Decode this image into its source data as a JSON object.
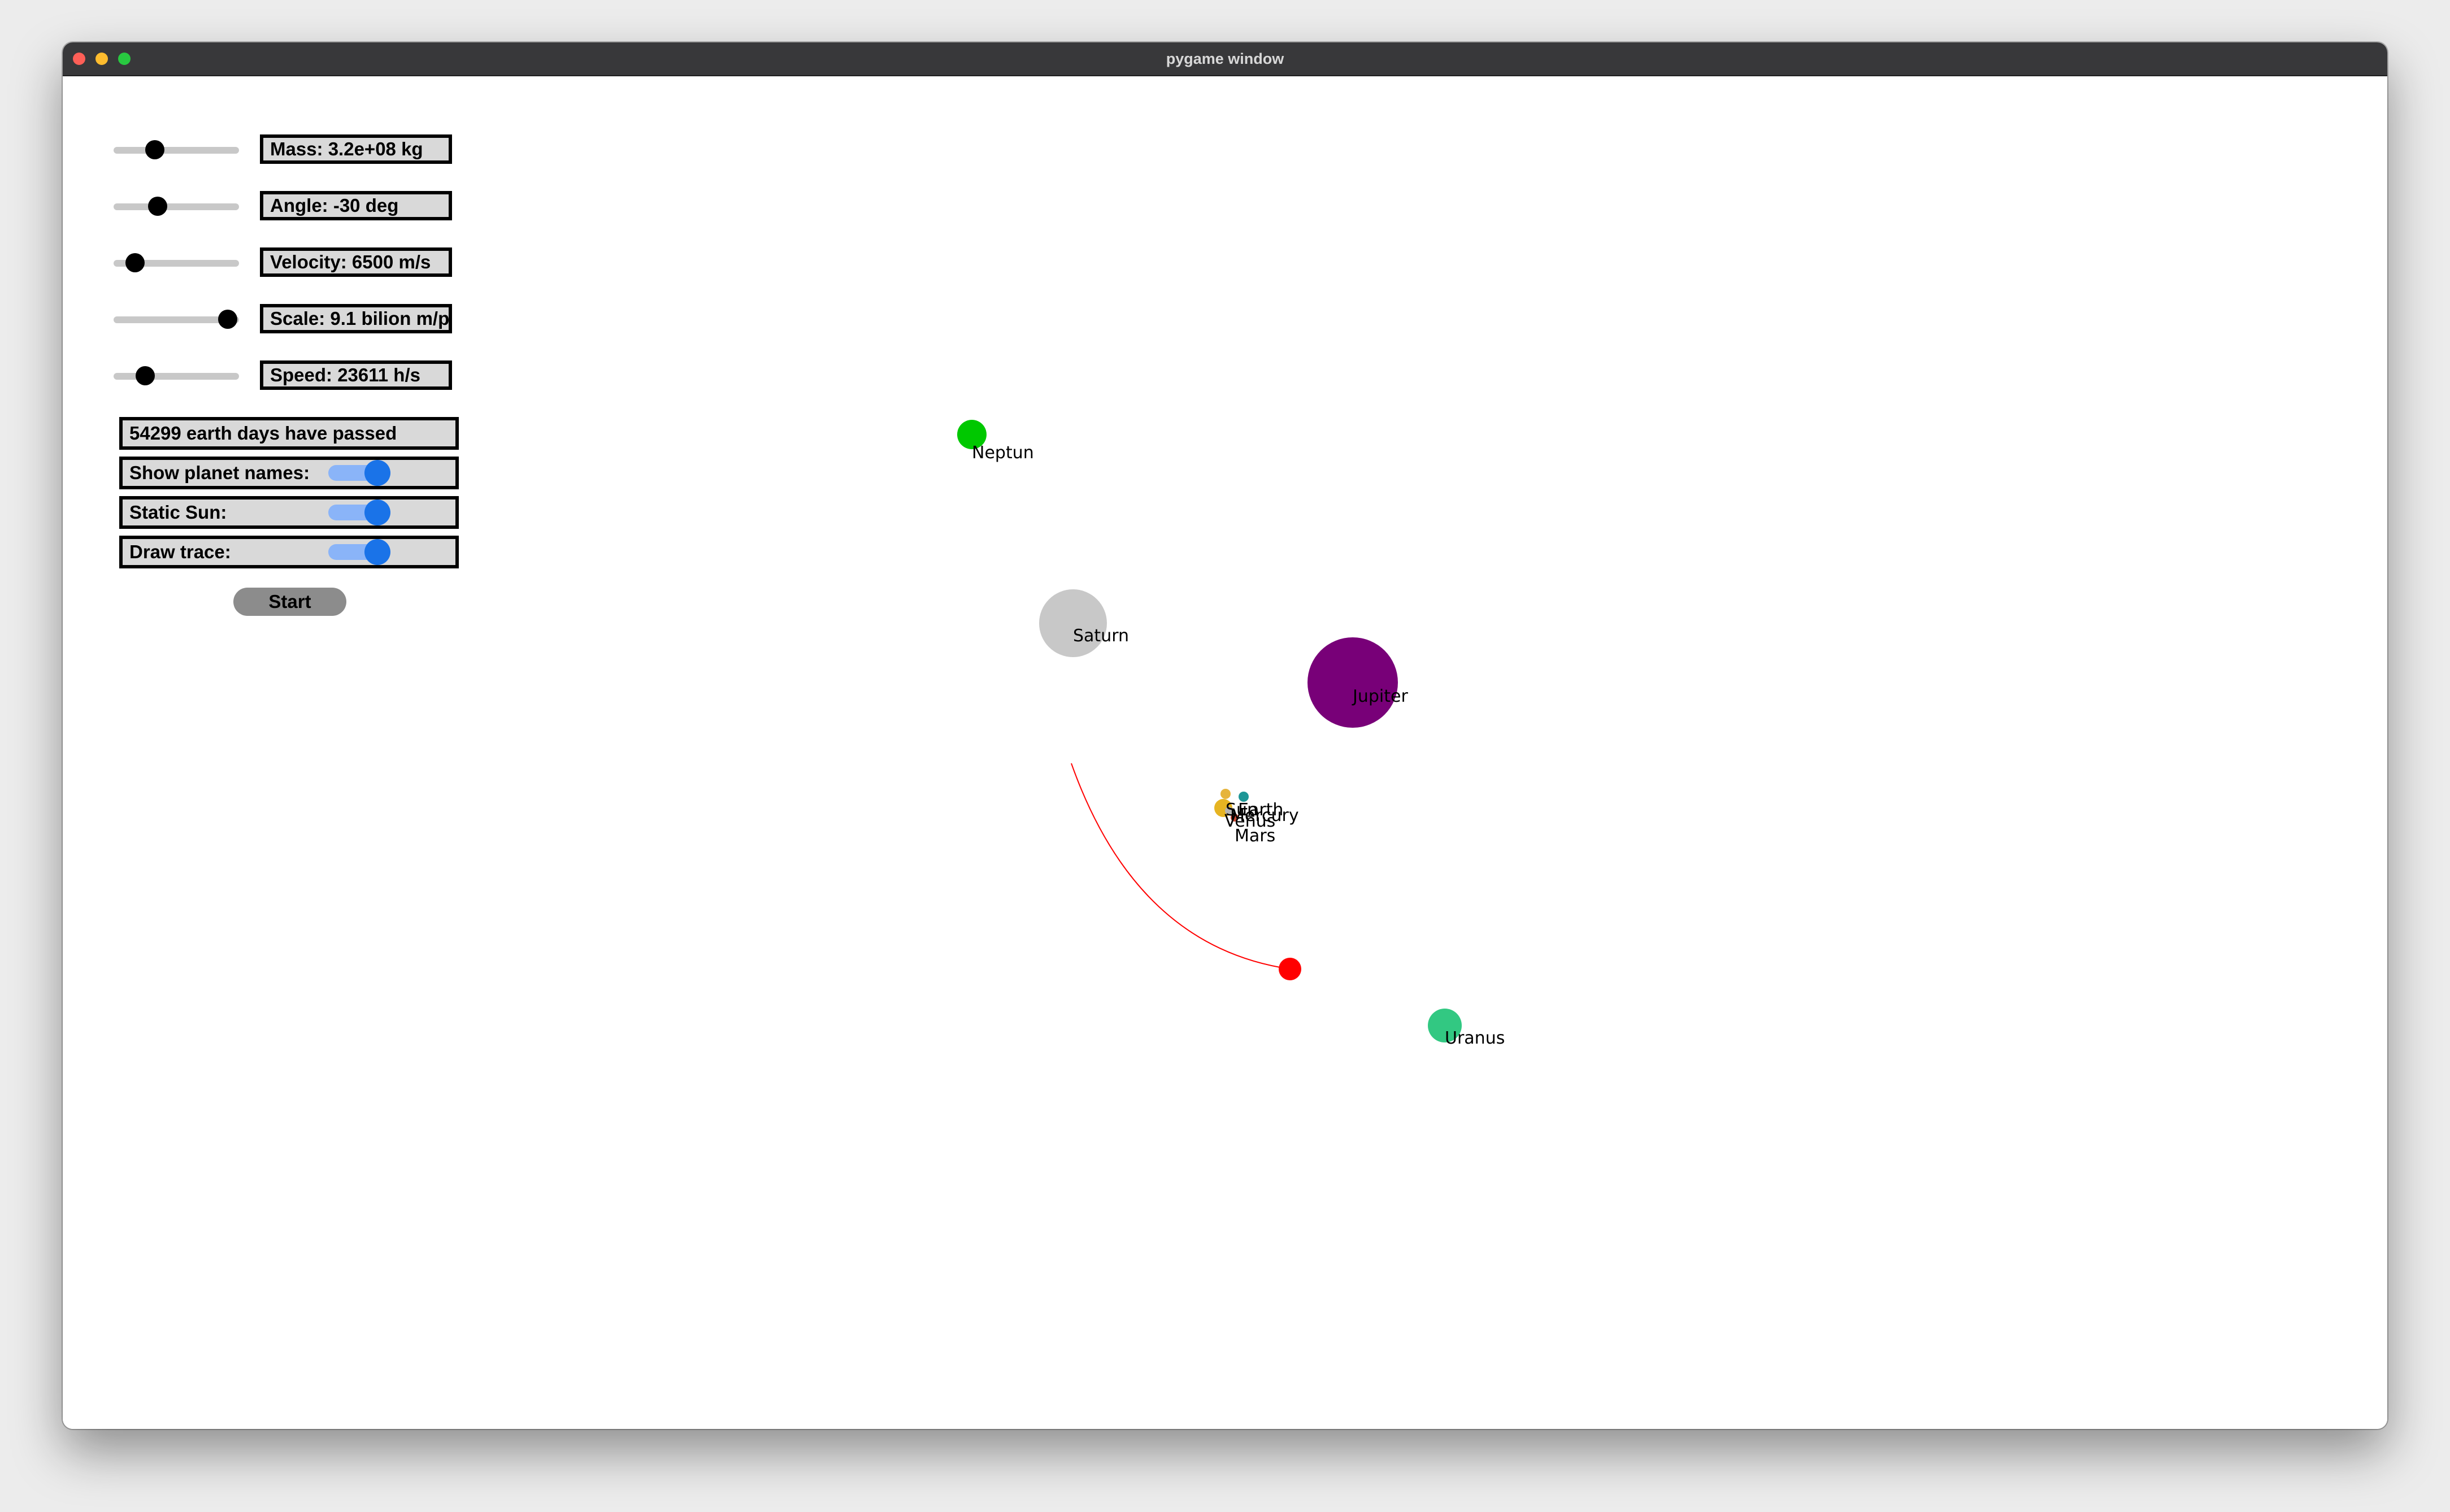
{
  "window": {
    "title": "pygame window"
  },
  "controls": {
    "mass": {
      "label": "Mass: 3.2e+08 kg",
      "slider_fraction": 0.33
    },
    "angle": {
      "label": "Angle: -30 deg",
      "slider_fraction": 0.35
    },
    "velocity": {
      "label": "Velocity: 6500 m/s",
      "slider_fraction": 0.17
    },
    "scale": {
      "label": "Scale: 9.1 bilion m/p",
      "slider_fraction": 0.91
    },
    "speed": {
      "label": "Speed: 23611 h/s",
      "slider_fraction": 0.25
    }
  },
  "status": {
    "days_passed": "54299 earth days have passed"
  },
  "toggles": [
    {
      "label": "Show planet names:",
      "on": true
    },
    {
      "label": "Static Sun:",
      "on": true
    },
    {
      "label": "Draw trace:",
      "on": true
    }
  ],
  "start_button": {
    "label": "Start"
  },
  "simulation": {
    "planets": [
      {
        "name": "Neptun",
        "color": "#00c800"
      },
      {
        "name": "Saturn",
        "color": "#c8c8c8"
      },
      {
        "name": "Jupiter",
        "color": "#780078"
      },
      {
        "name": "Uranus",
        "color": "#32c882"
      },
      {
        "name": "Sun",
        "color": "#e6b422"
      },
      {
        "name": "Earth",
        "color": "#1e9696"
      },
      {
        "name": "Mercury",
        "color": "#b4b4b4"
      },
      {
        "name": "Venus",
        "color": "#e6b43c"
      },
      {
        "name": "Mars",
        "color": "#c84632"
      }
    ],
    "projectile": {
      "color": "#ff0000",
      "trace_color": "#ff0000"
    }
  }
}
